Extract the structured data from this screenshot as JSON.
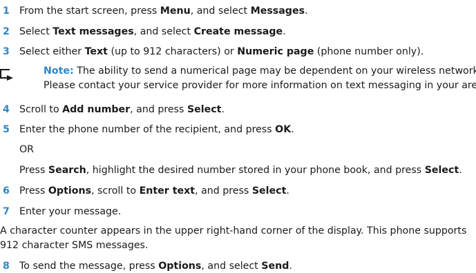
{
  "steps": [
    {
      "n": "1",
      "parts": [
        "From the start screen, press ",
        "Menu",
        ", and select ",
        "Messages",
        "."
      ]
    },
    {
      "n": "2",
      "parts": [
        "Select ",
        "Text messages",
        ", and select ",
        "Create message",
        "."
      ]
    },
    {
      "n": "3",
      "parts": [
        "Select either ",
        "Text",
        " (up to 912 characters) or ",
        "Numeric page",
        " (phone number only)."
      ]
    },
    {
      "n": "4",
      "parts": [
        "Scroll to ",
        "Add number",
        ", and press ",
        "Select",
        "."
      ]
    },
    {
      "n": "5",
      "parts": [
        "Enter the phone number of the recipient, and press ",
        "OK",
        "."
      ]
    },
    {
      "n": "6",
      "parts": [
        "Press ",
        "Options",
        ", scroll to ",
        "Enter text",
        ", and press ",
        "Select",
        "."
      ]
    },
    {
      "n": "7",
      "parts": [
        "Enter your message."
      ]
    },
    {
      "n": "8",
      "parts": [
        "To send the message, press ",
        "Options",
        ", and select ",
        "Send",
        "."
      ]
    }
  ],
  "note": {
    "label": "Note:",
    "line1": " The ability to send a numerical page may be dependent on your wireless network.",
    "line2": "Please contact your service provider for more information on text messaging in your area."
  },
  "or_text": "OR",
  "alt_step": {
    "parts": [
      "Press ",
      "Search",
      ", highlight the desired number stored in your phone book, and press ",
      "Select",
      "."
    ]
  },
  "counter_para": {
    "line1": "A character counter appears in the upper right-hand corner of the display. This phone supports",
    "line2": "912 character SMS messages."
  }
}
